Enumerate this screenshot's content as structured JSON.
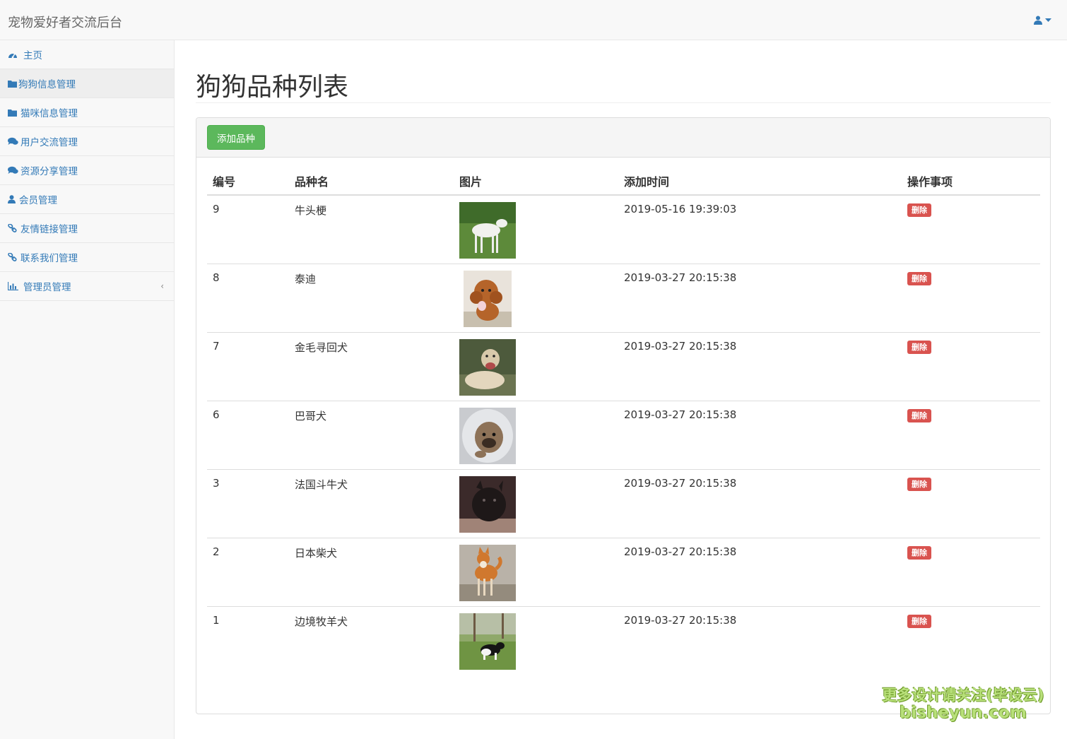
{
  "app": {
    "title": "宠物爱好者交流后台"
  },
  "sidebar": {
    "items": [
      {
        "label": "主页",
        "icon": "dashboard-icon"
      },
      {
        "label": "狗狗信息管理",
        "icon": "folder-icon",
        "active": true
      },
      {
        "label": "猫咪信息管理",
        "icon": "folder-icon"
      },
      {
        "label": "用户交流管理",
        "icon": "comments-icon"
      },
      {
        "label": "资源分享管理",
        "icon": "comments-icon"
      },
      {
        "label": "会员管理",
        "icon": "user-icon"
      },
      {
        "label": "友情链接管理",
        "icon": "link-icon"
      },
      {
        "label": "联系我们管理",
        "icon": "link-icon"
      },
      {
        "label": "管理员管理",
        "icon": "bar-chart-icon",
        "chevron": "‹"
      }
    ]
  },
  "page": {
    "title": "狗狗品种列表",
    "add_button": "添加品种"
  },
  "table": {
    "headers": [
      "编号",
      "品种名",
      "图片",
      "添加时间",
      "操作事项"
    ],
    "delete_label": "删除",
    "rows": [
      {
        "id": "9",
        "name": "牛头梗",
        "time": "2019-05-16 19:39:03"
      },
      {
        "id": "8",
        "name": "泰迪",
        "time": "2019-03-27 20:15:38"
      },
      {
        "id": "7",
        "name": "金毛寻回犬",
        "time": "2019-03-27 20:15:38"
      },
      {
        "id": "6",
        "name": "巴哥犬",
        "time": "2019-03-27 20:15:38"
      },
      {
        "id": "3",
        "name": "法国斗牛犬",
        "time": "2019-03-27 20:15:38"
      },
      {
        "id": "2",
        "name": "日本柴犬",
        "time": "2019-03-27 20:15:38"
      },
      {
        "id": "1",
        "name": "边境牧羊犬",
        "time": "2019-03-27 20:15:38"
      }
    ]
  },
  "watermark": {
    "line1": "更多设计请关注(毕设云)",
    "line2": "bisheyun.com"
  },
  "colors": {
    "link": "#337ab7",
    "success": "#5cb85c",
    "danger": "#d9534f"
  }
}
